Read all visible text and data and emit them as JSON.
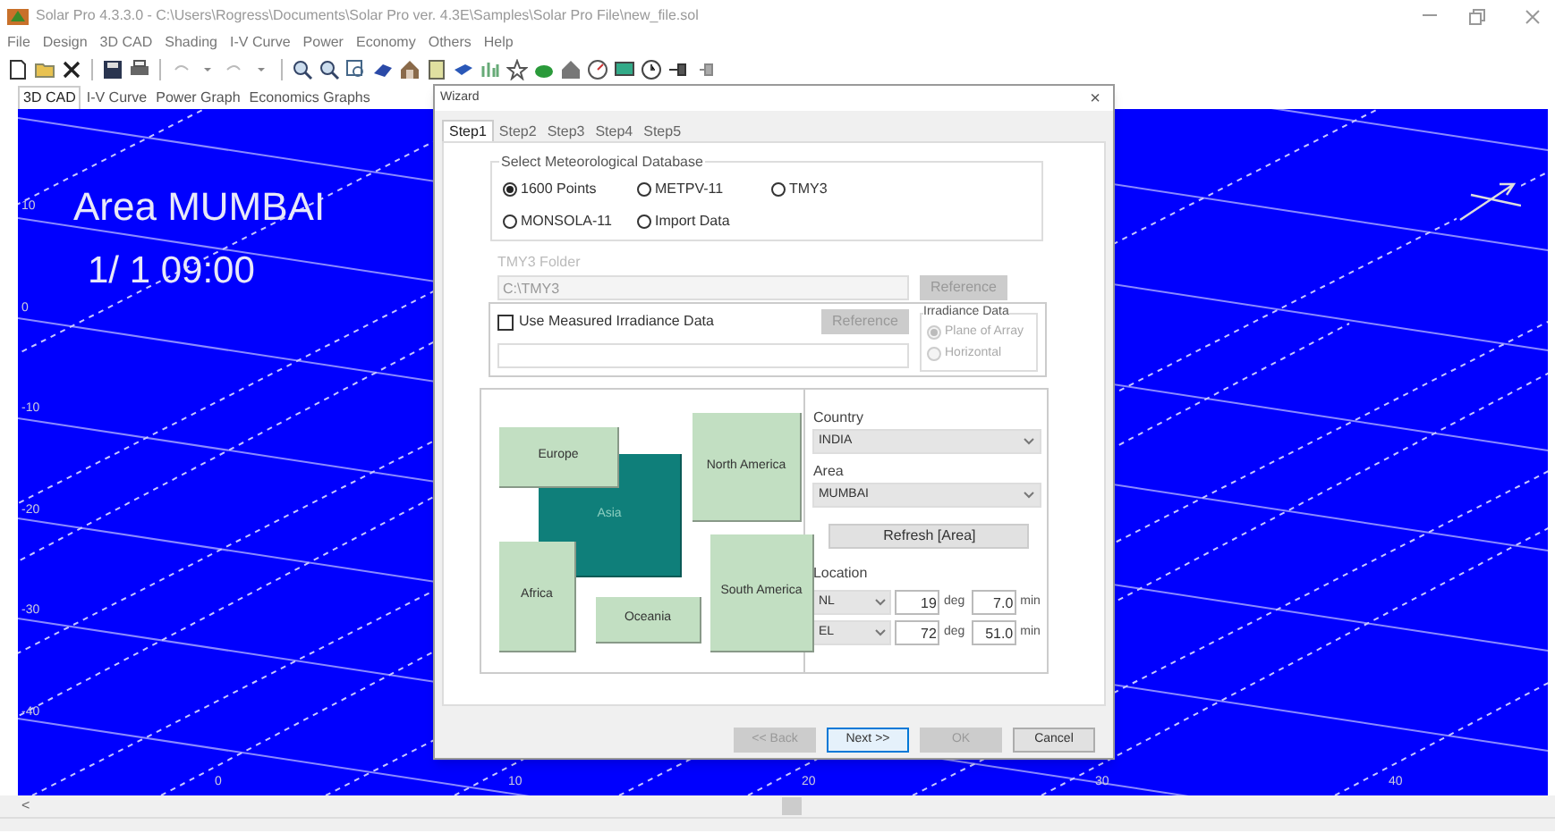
{
  "window": {
    "title": "Solar Pro 4.3.3.0 - C:\\Users\\Rogress\\Documents\\Solar Pro ver. 4.3E\\Samples\\Solar Pro File\\new_file.sol"
  },
  "menu": [
    "File",
    "Design",
    "3D CAD",
    "Shading",
    "I-V Curve",
    "Power",
    "Economy",
    "Others",
    "Help"
  ],
  "view_tabs": [
    {
      "label": "3D CAD",
      "selected": true
    },
    {
      "label": "I-V Curve",
      "selected": false
    },
    {
      "label": "Power Graph",
      "selected": false
    },
    {
      "label": "Economics Graphs",
      "selected": false
    }
  ],
  "canvas": {
    "area_label": "Area MUMBAI",
    "time_label": "1/ 1 09:00",
    "y_ticks": [
      "10",
      "0",
      "-10",
      "-20",
      "-30",
      "-40"
    ],
    "x_ticks": [
      "0",
      "10",
      "20",
      "30",
      "40"
    ]
  },
  "scrollbar": {
    "left_arrow": "<"
  },
  "wizard": {
    "title": "Wizard",
    "close": "×",
    "tabs": [
      {
        "label": "Step1",
        "selected": true
      },
      {
        "label": "Step2",
        "selected": false
      },
      {
        "label": "Step3",
        "selected": false
      },
      {
        "label": "Step4",
        "selected": false
      },
      {
        "label": "Step5",
        "selected": false
      }
    ],
    "database": {
      "legend": "Select Meteorological Database",
      "options": [
        {
          "label": "1600 Points",
          "selected": true
        },
        {
          "label": "METPV-11",
          "selected": false
        },
        {
          "label": "TMY3",
          "selected": false
        },
        {
          "label": "MONSOLA-11",
          "selected": false
        },
        {
          "label": "Import Data",
          "selected": false
        }
      ]
    },
    "tmy3_folder": {
      "label": "TMY3 Folder",
      "value": "C:\\TMY3",
      "button": "Reference",
      "disabled": true
    },
    "measured": {
      "label": "Use Measured Irradiance Data",
      "checked": false,
      "button": "Reference",
      "disabled": true
    },
    "irradiance": {
      "legend": "Irradiance Data",
      "disabled": true,
      "options": [
        {
          "label": "Plane of Array",
          "selected": true
        },
        {
          "label": "Horizontal",
          "selected": false
        }
      ]
    },
    "continents": [
      {
        "label": "Europe",
        "selected": false
      },
      {
        "label": "Asia",
        "selected": true
      },
      {
        "label": "North America",
        "selected": false
      },
      {
        "label": "Africa",
        "selected": false
      },
      {
        "label": "Oceania",
        "selected": false
      },
      {
        "label": "South America",
        "selected": false
      }
    ],
    "country": {
      "label": "Country",
      "value": "INDIA"
    },
    "area": {
      "label": "Area",
      "value": "MUMBAI"
    },
    "refresh_button": "Refresh [Area]",
    "location": {
      "label": "Location",
      "rows": [
        {
          "direction": "NL",
          "deg": "19",
          "deg_unit": "deg",
          "min": "7.0",
          "min_unit": "min"
        },
        {
          "direction": "EL",
          "deg": "72",
          "deg_unit": "deg",
          "min": "51.0",
          "min_unit": "min"
        }
      ]
    },
    "buttons": [
      {
        "label": "<< Back",
        "disabled": true,
        "focused": false
      },
      {
        "label": "Next >>",
        "disabled": false,
        "focused": true
      },
      {
        "label": "OK",
        "disabled": true,
        "focused": false
      },
      {
        "label": "Cancel",
        "disabled": false,
        "focused": false
      }
    ]
  }
}
